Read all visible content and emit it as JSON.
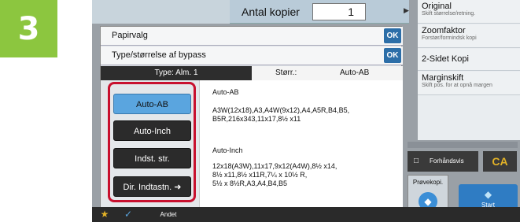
{
  "step_number": "3",
  "header": {
    "copies_label": "Antal kopier",
    "copies_value": "1"
  },
  "right_panel": {
    "items": [
      {
        "title": "Original",
        "subtitle": "Skift størrelse/retning."
      },
      {
        "title": "Zoomfaktor",
        "subtitle": "Forstør/formindsk kopi"
      },
      {
        "title": "2-Sidet Kopi",
        "subtitle": ""
      },
      {
        "title": "Marginskift",
        "subtitle": "Skift pos. for at opnå margen"
      }
    ]
  },
  "dialog": {
    "row1_label": "Papirvalg",
    "row2_label": "Type/størrelse af bypass",
    "ok_label": "OK",
    "type_tab": "Type:  Alm. 1",
    "size_label": "Størr.:",
    "size_value": "Auto-AB",
    "buttons": [
      "Auto-AB",
      "Auto-Inch",
      "Indst. str.",
      "Dir. Indtastn."
    ],
    "auto_ab_title": "Auto-AB",
    "auto_ab_sizes": [
      "A3W(12x18),A3,A4W(9x12),A4,A5R,B4,B5,",
      "B5R,216x343,11x17,8½ x11"
    ],
    "auto_inch_title": "Auto-Inch",
    "auto_inch_sizes": [
      "12x18(A3W),11x17,9x12(A4W),8½ x14,",
      "8½ x11,8½ x11R,7¼ x 10½ R,",
      "5½ x 8½R,A3,A4,B4,B5"
    ]
  },
  "bottom": {
    "other_label": "Andet"
  },
  "actions": {
    "preview_label": "Forhåndsvis",
    "ca_label": "CA",
    "proof_label": "Prøvekopi.",
    "start_label": "Start"
  }
}
